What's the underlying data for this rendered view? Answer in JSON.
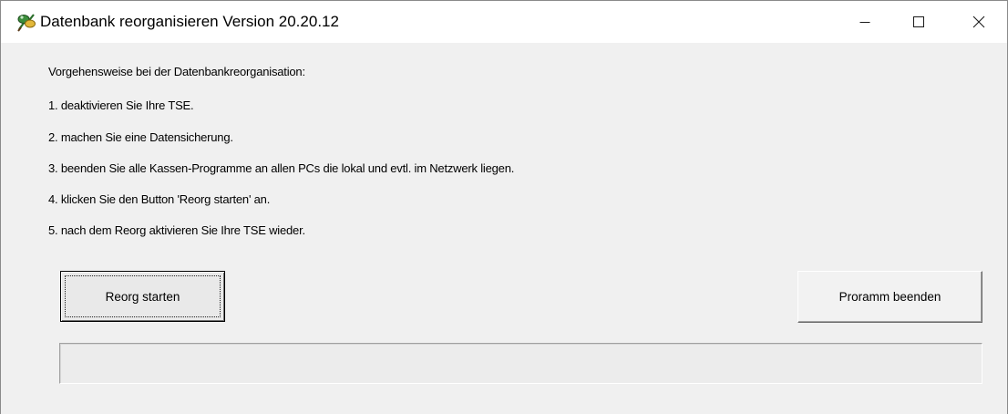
{
  "window": {
    "title": "Datenbank reorganisieren Version 20.20.12",
    "controls": {
      "minimize": "minimize-icon",
      "maximize": "maximize-icon",
      "close": "close-icon"
    }
  },
  "instructions": {
    "heading": "Vorgehensweise bei der Datenbankreorganisation:",
    "steps": [
      "1. deaktivieren Sie Ihre TSE.",
      "2. machen Sie eine Datensicherung.",
      "3. beenden Sie alle Kassen-Programme an allen PCs die lokal und evtl. im Netzwerk liegen.",
      "4. klicken Sie den Button  'Reorg starten' an.",
      "5. nach dem Reorg aktivieren Sie Ihre TSE wieder."
    ]
  },
  "buttons": {
    "reorg_start": "Reorg starten",
    "quit": "Proramm beenden"
  },
  "progress": {
    "value": 0
  }
}
